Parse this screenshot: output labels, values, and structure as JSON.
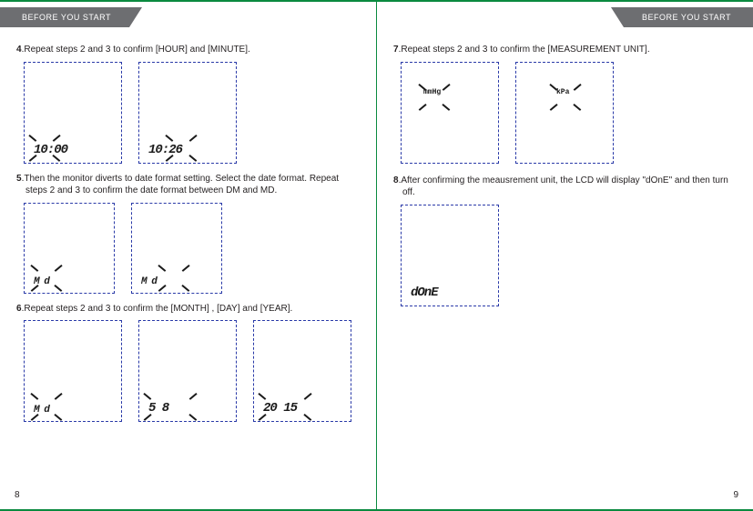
{
  "header": {
    "left_tab": "BEFORE YOU START",
    "right_tab": "BEFORE YOU START"
  },
  "left_page": {
    "step4": {
      "num": "4",
      "text": ".Repeat steps 2 and 3 to confirm [HOUR] and [MINUTE]."
    },
    "step4_lcd": [
      "10:00",
      "10:26"
    ],
    "step5": {
      "num": "5",
      "text": ".Then the monitor diverts to date format setting. Select the date format. Repeat steps 2 and 3 to confirm the date format between DM and MD."
    },
    "step5_lcd": [
      "M  d",
      "M  d"
    ],
    "step6": {
      "num": "6",
      "text": ".Repeat steps 2 and 3 to confirm the [MONTH] , [DAY] and [YEAR]."
    },
    "step6_lcd": [
      "M  d",
      "5  8",
      "20 15"
    ],
    "page_number": "8"
  },
  "right_page": {
    "step7": {
      "num": "7",
      "text": ".Repeat steps 2 and 3 to confirm the [MEASUREMENT UNIT]."
    },
    "step7_lcd_labels": [
      "mmHg",
      "kPa"
    ],
    "step8": {
      "num": "8",
      "text": ".After confirming the meausrement unit, the LCD will display \"dOnE\" and then turn off."
    },
    "step8_lcd": "dOnE",
    "page_number": "9"
  }
}
